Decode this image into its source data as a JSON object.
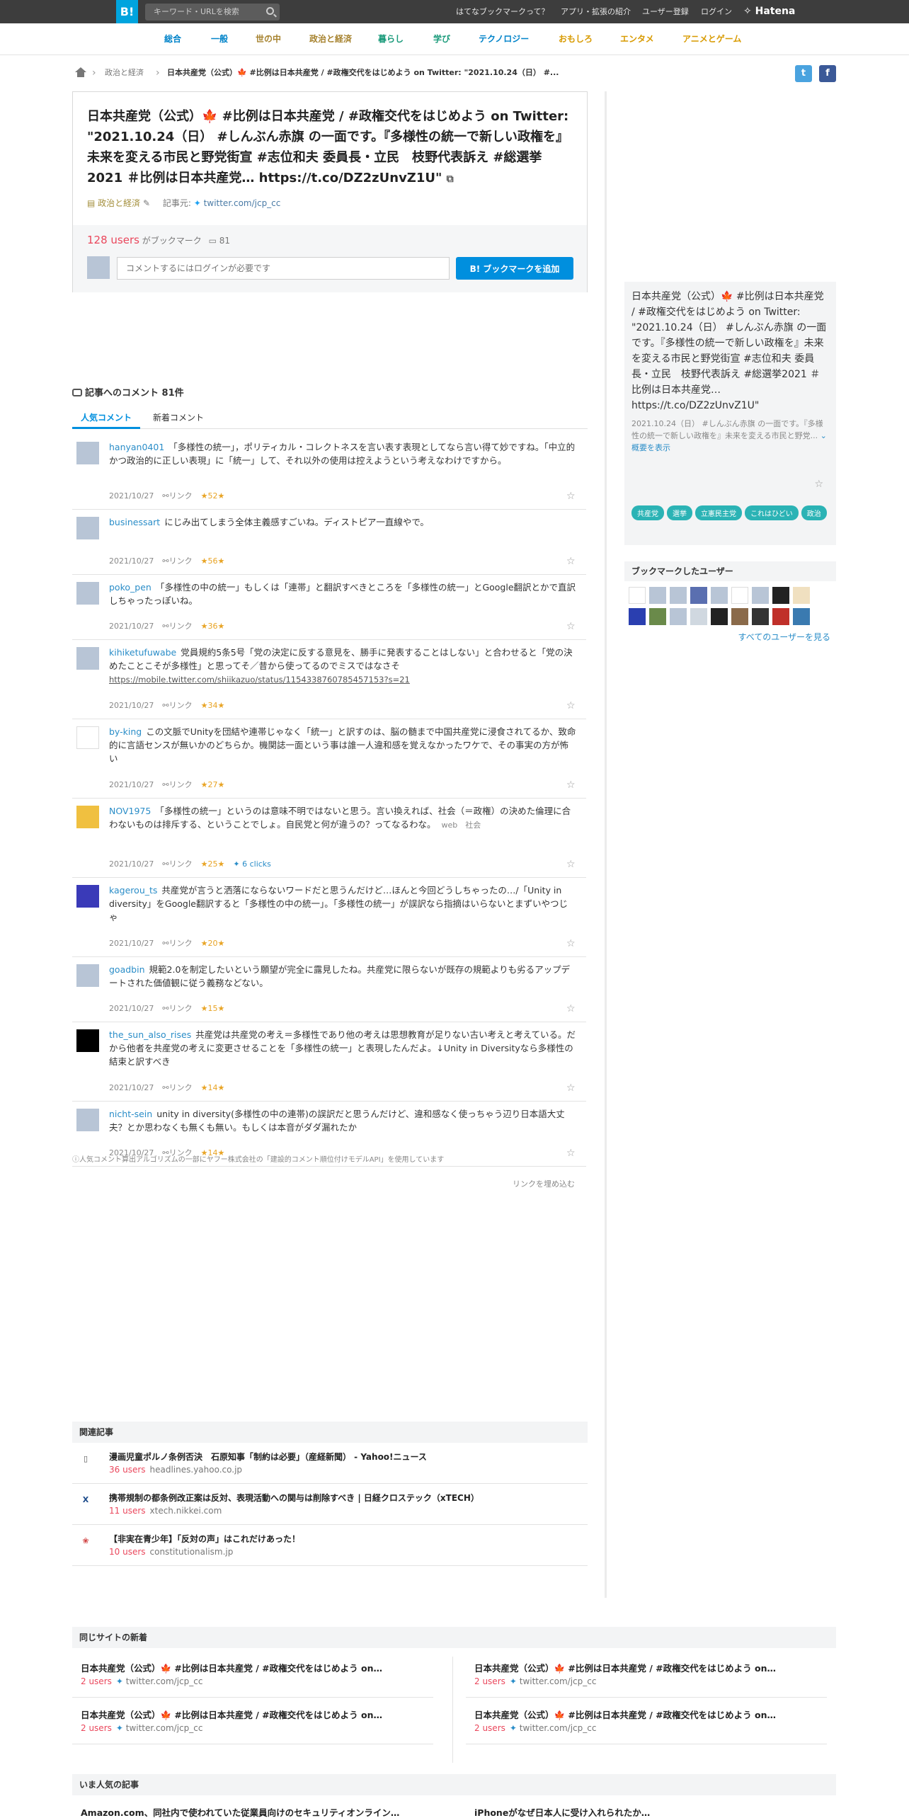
{
  "header": {
    "logo": "B!",
    "search_placeholder": "キーワード・URLを検索",
    "links": [
      "はてなブックマークって？",
      "アプリ・拡張の紹介",
      "ユーザー登録",
      "ログイン"
    ],
    "brand": "Hatena"
  },
  "categories": [
    {
      "label": "総合",
      "color": "#0083c9"
    },
    {
      "label": "一般",
      "color": "#0083c9"
    },
    {
      "label": "世の中",
      "color": "#a6822e"
    },
    {
      "label": "政治と経済",
      "color": "#a6822e"
    },
    {
      "label": "暮らし",
      "color": "#199a7a"
    },
    {
      "label": "学び",
      "color": "#199a7a"
    },
    {
      "label": "テクノロジー",
      "color": "#0083c9"
    },
    {
      "label": "おもしろ",
      "color": "#d89a00"
    },
    {
      "label": "エンタメ",
      "color": "#d89a00"
    },
    {
      "label": "アニメとゲーム",
      "color": "#d89a00"
    }
  ],
  "breadcrumb": {
    "category": "政治と経済",
    "current": "日本共産党（公式）🍁 #比例は日本共産党 / #政権交代をはじめよう on Twitter: \"2021.10.24（日） #..."
  },
  "entry": {
    "title": "日本共産党（公式）🍁 #比例は日本共産党 / #政権交代をはじめよう on Twitter: \"2021.10.24（日） #しんぶん赤旗 の一面です。『多様性の統一で新しい政権を』未来を変える市民と野党街宣 #志位和夫 委員長・立民　枝野代表訴え #総選挙2021 ＃比例は日本共産党… https://t.co/DZ2zUnvZ1U\"",
    "category": "政治と経済",
    "source_label": "記事元:",
    "source": "twitter.com/jcp_cc",
    "users_count": "128 users",
    "users_suffix": "がブックマーク",
    "comment_count": "81",
    "comment_placeholder": "コメントするにはログインが必要です",
    "add_button": "ブックマークを追加"
  },
  "comments_section": {
    "heading": "記事へのコメント 81件",
    "tabs": [
      "人気コメント",
      "新着コメント"
    ],
    "link_label": "リンク"
  },
  "comments": [
    {
      "user": "hanyan0401",
      "text": "「多様性の統一」，ポリティカル・コレクトネスを言い表す表現としてなら言い得て妙ですね。「中立的かつ政治的に正しい表現」に「統一」して、それ以外の使用は控えようという考えなわけですから。",
      "date": "2021/10/27",
      "stars": "52",
      "avatar": "#b8c5d6"
    },
    {
      "user": "businessart",
      "text": "にじみ出てしまう全体主義感すごいね。ディストピア一直線やで。",
      "date": "2021/10/27",
      "stars": "56",
      "avatar": "#b8c5d6"
    },
    {
      "user": "poko_pen",
      "text": "「多様性の中の統一」もしくは「連帯」と翻訳すべきところを「多様性の統一」とGoogle翻訳とかで直訳しちゃったっぽいね。",
      "date": "2021/10/27",
      "stars": "36",
      "avatar": "#b8c5d6"
    },
    {
      "user": "kihiketufuwabe",
      "text": "党員規約5条5号「党の決定に反する意見を、勝手に発表することはしない」と合わせると「党の決めたことこそが多様性」と思ってそ／昔から使ってるのでミスではなさそ",
      "link": "https://mobile.twitter.com/shiikazuo/status/1154338760785457153?s=21",
      "date": "2021/10/27",
      "stars": "34",
      "avatar": "#b8c5d6"
    },
    {
      "user": "by-king",
      "text": "この文脈でUnityを団結や連帯じゃなく「統一」と訳すのは、脳の髄まで中国共産党に浸食されてるか、致命的に言語センスが無いかのどちらか。機関誌一面という事は誰一人違和感を覚えなかったワケで、その事実の方が怖い",
      "date": "2021/10/27",
      "stars": "27",
      "avatar": "#ffffff"
    },
    {
      "user": "NOV1975",
      "text": "「多様性の統一」というのは意味不明ではないと思う。言い換えれば、社会（＝政権）の決めた倫理に合わないものは排斥する、ということでしょ。自民党と何が違うの？ってなるわな。",
      "tags": "web　社会",
      "date": "2021/10/27",
      "stars": "25",
      "clicks": "6 clicks",
      "avatar": "#f0c040"
    },
    {
      "user": "kagerou_ts",
      "text": "共産党が言うと洒落にならないワードだと思うんだけど…ほんと今回どうしちゃったの…/「Unity in diversity」をGoogle翻訳すると「多様性の中の統一」。「多様性の統一」が誤訳なら指摘はいらないとまずいやつじゃ",
      "date": "2021/10/27",
      "stars": "20",
      "avatar": "#3a3ab8"
    },
    {
      "user": "goadbin",
      "text": "規範2.0を制定したいという願望が完全に露見したね。共産党に限らないが既存の規範よりも劣るアップデートされた価値観に従う義務などない。",
      "date": "2021/10/27",
      "stars": "15",
      "avatar": "#b8c5d6"
    },
    {
      "user": "the_sun_also_rises",
      "text": "共産党は共産党の考え＝多様性であり他の考えは思想教育が足りない古い考えと考えている。だから他者を共産党の考えに変更させることを「多様性の統一」と表現したんだよ。↓Unity in Diversityなら多様性の結束と訳すべき",
      "date": "2021/10/27",
      "stars": "14",
      "avatar": "#000000"
    },
    {
      "user": "nicht-sein",
      "text": "unity in diversity(多様性の中の連帯)の誤訳だと思うんだけど、違和感なく使っちゃう辺り日本語大丈夫？とか思わなくも無くも無い。もしくは本音がダダ漏れたか",
      "date": "2021/10/27",
      "stars": "14",
      "avatar": "#b8c5d6"
    }
  ],
  "algo_note": "ⓘ人気コメント算出アルゴリズムの一部にヤフー株式会社の「建設的コメント順位付けモデルAPI」を使用しています",
  "embed_link": "リンクを埋め込む",
  "related": {
    "heading": "関連記事",
    "items": [
      {
        "title": "漫画児童ポルノ条例否決　石原知事「制約は必要」（産経新聞） - Yahoo!ニュース",
        "users": "36 users",
        "domain": "headlines.yahoo.co.jp",
        "icon": "doc-icon"
      },
      {
        "title": "携帯規制の都条例改正案は反対、表現活動への関与は削除すべき | 日経クロステック（xTECH）",
        "users": "11 users",
        "domain": "xtech.nikkei.com",
        "icon": "x-icon"
      },
      {
        "title": "【非実在青少年】「反対の声」はこれだけあった！",
        "users": "10 users",
        "domain": "constitutionalism.jp",
        "icon": "site-icon"
      }
    ]
  },
  "sidebar": {
    "entry_title": "日本共産党（公式）🍁 #比例は日本共産党 / #政権交代をはじめよう on Twitter: \"2021.10.24（日） #しんぶん赤旗 の一面です。『多様性の統一で新しい政権を』未来を変える市民と野党街宣 #志位和夫 委員長・立民　枝野代表訴え #総選挙2021 ＃比例は日本共産党… https://t.co/DZ2zUnvZ1U\"",
    "entry_desc": "2021.10.24（日） #しんぶん赤旗 の一面です。『多様性の統一で新しい政権を』未来を変える市民と野党...",
    "more": "概要を表示",
    "tags": [
      "共産党",
      "選挙",
      "立憲民主党",
      "これはひどい",
      "政治"
    ],
    "users_heading": "ブックマークしたユーザー",
    "all_users": "すべてのユーザーを見る",
    "user_avatars": [
      "#ffffff",
      "#b8c5d6",
      "#b8c5d6",
      "#5a6fb0",
      "#b8c5d6",
      "#ffffff",
      "#b8c5d6",
      "#222222",
      "#f0e0c0",
      "#2a3fb0",
      "#6a8a4a",
      "#b8c5d6",
      "#d0d8e0",
      "#222222",
      "#8a6a4a",
      "#333333",
      "#c0302a",
      "#3a7ab0"
    ]
  },
  "same_site": {
    "heading": "同じサイトの新着",
    "items": [
      {
        "title": "日本共産党（公式）🍁 #比例は日本共産党 / #政権交代をはじめよう on…",
        "users": "2 users",
        "domain": "twitter.com/jcp_cc"
      },
      {
        "title": "日本共産党（公式）🍁 #比例は日本共産党 / #政権交代をはじめよう on…",
        "users": "2 users",
        "domain": "twitter.com/jcp_cc"
      },
      {
        "title": "日本共産党（公式）🍁 #比例は日本共産党 / #政権交代をはじめよう on…",
        "users": "2 users",
        "domain": "twitter.com/jcp_cc"
      },
      {
        "title": "日本共産党（公式）🍁 #比例は日本共産党 / #政権交代をはじめよう on…",
        "users": "2 users",
        "domain": "twitter.com/jcp_cc"
      }
    ]
  },
  "popular": {
    "heading": "いま人気の記事",
    "items": [
      "Amazon.com、同社内で使われていた従業員向けのセキュリティオンライン…",
      "iPhoneがなぜ日本人に受け入れられたか…"
    ]
  }
}
